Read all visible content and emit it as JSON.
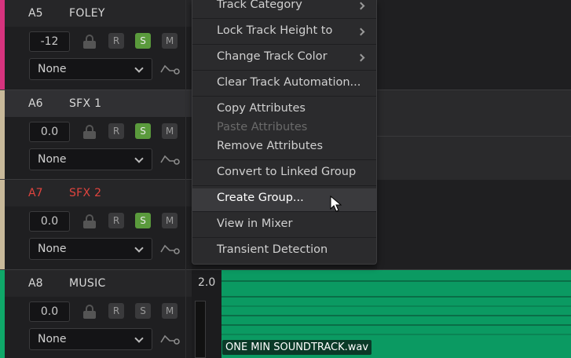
{
  "tracks": [
    {
      "id": "A5",
      "name": "FOLEY",
      "volume": "-12",
      "solo_active": true,
      "input": "None",
      "color": "#d6337e",
      "highlight": false
    },
    {
      "id": "A6",
      "name": "SFX 1",
      "volume": "0.0",
      "solo_active": true,
      "input": "None",
      "color": "#c8b99a",
      "highlight": false
    },
    {
      "id": "A7",
      "name": "SFX 2",
      "volume": "0.0",
      "solo_active": true,
      "input": "None",
      "color": "#c8b99a",
      "highlight": true
    },
    {
      "id": "A8",
      "name": "MUSIC",
      "volume": "0.0",
      "solo_active": false,
      "input": "None",
      "color": "#0fa869",
      "highlight": false
    }
  ],
  "buttons": {
    "record": "R",
    "solo": "S",
    "mute": "M"
  },
  "music_gain": "2.0",
  "context_menu": {
    "items": [
      {
        "label": "Track Category",
        "submenu": true,
        "disabled": false
      },
      {
        "label": "Lock Track Height to",
        "submenu": true,
        "disabled": false
      },
      {
        "label": "Change Track Color",
        "submenu": true,
        "disabled": false
      },
      {
        "label": "Clear Track Automation...",
        "submenu": false,
        "disabled": false
      },
      {
        "label": "Copy Attributes",
        "submenu": false,
        "disabled": false
      },
      {
        "label": "Paste Attributes",
        "submenu": false,
        "disabled": true
      },
      {
        "label": "Remove Attributes",
        "submenu": false,
        "disabled": false
      },
      {
        "label": "Convert to Linked Group",
        "submenu": false,
        "disabled": false
      },
      {
        "label": "Create Group...",
        "submenu": false,
        "disabled": false,
        "hovered": true
      },
      {
        "label": "View in Mixer",
        "submenu": false,
        "disabled": false
      },
      {
        "label": "Transient Detection",
        "submenu": false,
        "disabled": false
      }
    ]
  },
  "clip": {
    "name": "ONE MIN SOUNDTRACK.wav",
    "color": "#0b9a62"
  },
  "colors": {
    "accent_red": "#e0443e",
    "solo_green": "#5a9a3c"
  }
}
